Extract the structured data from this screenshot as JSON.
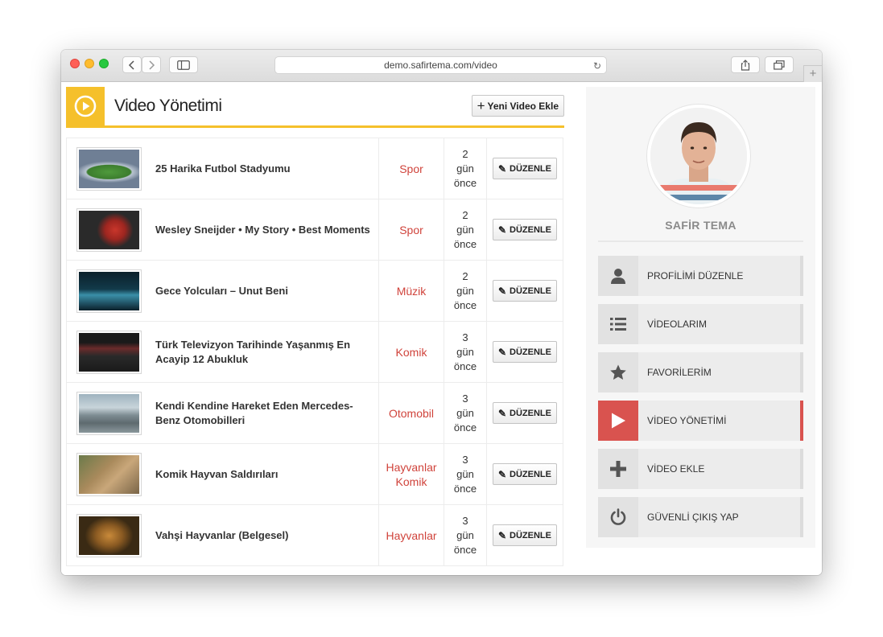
{
  "browser": {
    "url": "demo.safirtema.com/video"
  },
  "header": {
    "title": "Video Yönetimi",
    "add_button_label": "Yeni Video Ekle"
  },
  "videos": [
    {
      "title": "25 Harika Futbol Stadyumu",
      "category": "Spor",
      "date": [
        "2",
        "gün",
        "önce"
      ],
      "edit_label": "DÜZENLE"
    },
    {
      "title": "Wesley Sneijder • My Story • Best Moments",
      "category": "Spor",
      "date": [
        "2",
        "gün",
        "önce"
      ],
      "edit_label": "DÜZENLE"
    },
    {
      "title": "Gece Yolcuları – Unut Beni",
      "category": "Müzik",
      "date": [
        "2",
        "gün",
        "önce"
      ],
      "edit_label": "DÜZENLE"
    },
    {
      "title": "Türk Televizyon Tarihinde Yaşanmış En Acayip 12 Abukluk",
      "category": "Komik",
      "date": [
        "3",
        "gün",
        "önce"
      ],
      "edit_label": "DÜZENLE"
    },
    {
      "title": "Kendi Kendine Hareket Eden Mercedes-Benz Otomobilleri",
      "category": "Otomobil",
      "date": [
        "3",
        "gün",
        "önce"
      ],
      "edit_label": "DÜZENLE"
    },
    {
      "title": "Komik Hayvan Saldırıları",
      "category": "Hayvanlar Komik",
      "category_lines": [
        "Hayvanlar",
        "Komik"
      ],
      "date": [
        "3",
        "gün",
        "önce"
      ],
      "edit_label": "DÜZENLE"
    },
    {
      "title": "Vahşi Hayvanlar (Belgesel)",
      "category": "Hayvanlar",
      "date": [
        "3",
        "gün",
        "önce"
      ],
      "edit_label": "DÜZENLE"
    }
  ],
  "thumbnail_icons": [
    "stadium-thumbnail",
    "footballer-thumbnail",
    "music-video-thumbnail",
    "tv-text-thumbnail",
    "car-thumbnail",
    "animals-thumbnail",
    "lion-thumbnail"
  ],
  "sidebar": {
    "user_name": "SAFİR TEMA",
    "menu": [
      {
        "label": "PROFİLİMİ DÜZENLE",
        "icon": "user-icon"
      },
      {
        "label": "VİDEOLARIM",
        "icon": "list-icon"
      },
      {
        "label": "FAVORİLERİM",
        "icon": "star-icon"
      },
      {
        "label": "VİDEO YÖNETİMİ",
        "icon": "play-icon",
        "active": true
      },
      {
        "label": "VİDEO EKLE",
        "icon": "plus-icon"
      },
      {
        "label": "GÜVENLİ ÇIKIŞ YAP",
        "icon": "power-icon"
      }
    ]
  },
  "colors": {
    "accent_yellow": "#f5c02b",
    "active_red": "#d9534f",
    "category_red": "#d0433b"
  }
}
